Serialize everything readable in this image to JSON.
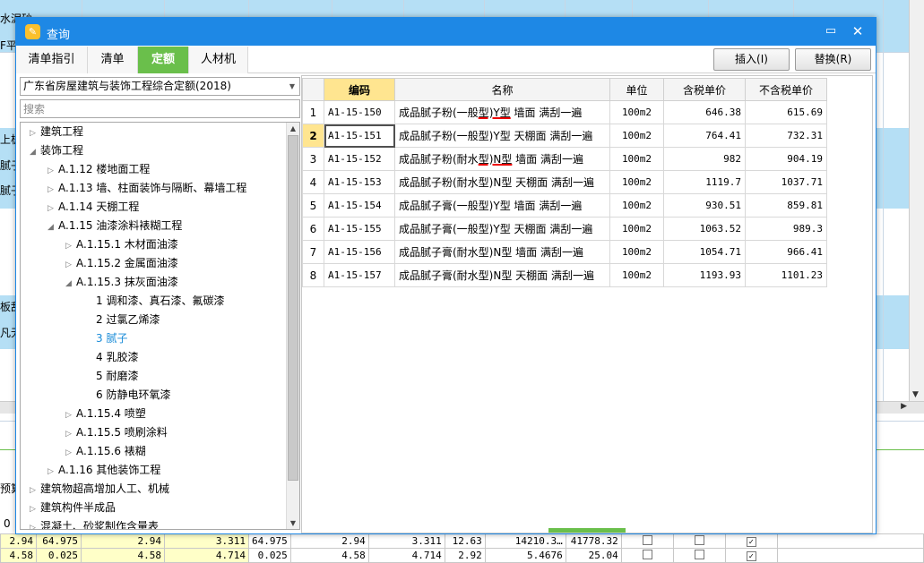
{
  "background": {
    "left_fragments": [
      "水泥砂",
      "F平",
      "上板",
      "腻子",
      "腻子",
      "板刮",
      "凡无机",
      "预算",
      "0"
    ],
    "bottom_rows": [
      {
        "cells": [
          "2.94",
          "64.975",
          "2.94",
          "3.311",
          "64.975",
          "2.94",
          "3.311",
          "12.63",
          "14210.3…",
          "41778.32"
        ],
        "checks": [
          false,
          false,
          true
        ]
      },
      {
        "cells": [
          "4.58",
          "0.025",
          "4.58",
          "4.714",
          "0.025",
          "4.58",
          "4.714",
          "2.92",
          "5.4676",
          "25.04"
        ],
        "checks": [
          false,
          false,
          true
        ]
      }
    ]
  },
  "dialog": {
    "title": "查询",
    "icons": {
      "app": "app-logo-icon",
      "minimize": "minimize-icon",
      "close": "close-icon"
    },
    "tabs": [
      {
        "label": "清单指引",
        "active": false
      },
      {
        "label": "清单",
        "active": false
      },
      {
        "label": "定额",
        "active": true
      },
      {
        "label": "人材机",
        "active": false
      }
    ],
    "insert_label": "插入(I)",
    "replace_label": "替换(R)",
    "accent": "#1e88e5",
    "tab_active_color": "#6abf4b"
  },
  "left": {
    "dept_select": "广东省房屋建筑与装饰工程综合定额(2018)",
    "search_placeholder": "搜索",
    "tree": [
      {
        "label": "建筑工程",
        "level": 0,
        "toggle": "▷"
      },
      {
        "label": "装饰工程",
        "level": 0,
        "toggle": "◢"
      },
      {
        "label": "A.1.12 楼地面工程",
        "level": 1,
        "toggle": "▷"
      },
      {
        "label": "A.1.13 墙、柱面装饰与隔断、幕墙工程",
        "level": 1,
        "toggle": "▷"
      },
      {
        "label": "A.1.14 天棚工程",
        "level": 1,
        "toggle": "▷"
      },
      {
        "label": "A.1.15 油漆涂料裱糊工程",
        "level": 1,
        "toggle": "◢"
      },
      {
        "label": "A.1.15.1 木材面油漆",
        "level": 2,
        "toggle": "▷"
      },
      {
        "label": "A.1.15.2 金属面油漆",
        "level": 2,
        "toggle": "▷"
      },
      {
        "label": "A.1.15.3 抹灰面油漆",
        "level": 2,
        "toggle": "◢"
      },
      {
        "label": "1 调和漆、真石漆、氟碳漆",
        "level": 3,
        "toggle": ""
      },
      {
        "label": "2 过氯乙烯漆",
        "level": 3,
        "toggle": ""
      },
      {
        "label": "3 腻子",
        "level": 3,
        "toggle": "",
        "selected": true
      },
      {
        "label": "4 乳胶漆",
        "level": 3,
        "toggle": ""
      },
      {
        "label": "5 耐磨漆",
        "level": 3,
        "toggle": ""
      },
      {
        "label": "6 防静电环氧漆",
        "level": 3,
        "toggle": ""
      },
      {
        "label": "A.1.15.4 喷塑",
        "level": 2,
        "toggle": "▷"
      },
      {
        "label": "A.1.15.5 喷刷涂料",
        "level": 2,
        "toggle": "▷"
      },
      {
        "label": "A.1.15.6 裱糊",
        "level": 2,
        "toggle": "▷"
      },
      {
        "label": "A.1.16 其他装饰工程",
        "level": 1,
        "toggle": "▷"
      },
      {
        "label": "建筑物超高增加人工、机械",
        "level": 0,
        "toggle": "▷"
      },
      {
        "label": "建筑构件半成品",
        "level": 0,
        "toggle": "▷"
      },
      {
        "label": "混凝土、砂浆制作含量表",
        "level": 0,
        "toggle": "▷"
      }
    ]
  },
  "grid": {
    "headers": [
      "编码",
      "名称",
      "单位",
      "含税单价",
      "不含税单价"
    ],
    "current_row": 2,
    "rows": [
      {
        "idx": "1",
        "code": "A1-15-150",
        "name_pre": "成品腻子粉(一般",
        "name_ul": "型)Y型",
        "name_post": " 墙面 满刮一遍",
        "unit": "100m2",
        "tax": "646.38",
        "notax": "615.69"
      },
      {
        "idx": "2",
        "code": "A1-15-151",
        "name_pre": "成品腻子粉(一般型)Y型 天棚面 满刮一遍",
        "name_ul": "",
        "name_post": "",
        "unit": "100m2",
        "tax": "764.41",
        "notax": "732.31"
      },
      {
        "idx": "3",
        "code": "A1-15-152",
        "name_pre": "成品腻子粉(耐水",
        "name_ul": "型)N型",
        "name_post": " 墙面 满刮一遍",
        "unit": "100m2",
        "tax": "982",
        "notax": "904.19"
      },
      {
        "idx": "4",
        "code": "A1-15-153",
        "name_pre": "成品腻子粉(耐水型)N型 天棚面 满刮一遍",
        "name_ul": "",
        "name_post": "",
        "unit": "100m2",
        "tax": "1119.7",
        "notax": "1037.71"
      },
      {
        "idx": "5",
        "code": "A1-15-154",
        "name_pre": "成品腻子膏(一般型)Y型 墙面 满刮一遍",
        "name_ul": "",
        "name_post": "",
        "unit": "100m2",
        "tax": "930.51",
        "notax": "859.81"
      },
      {
        "idx": "6",
        "code": "A1-15-155",
        "name_pre": "成品腻子膏(一般型)Y型 天棚面 满刮一遍",
        "name_ul": "",
        "name_post": "",
        "unit": "100m2",
        "tax": "1063.52",
        "notax": "989.3"
      },
      {
        "idx": "7",
        "code": "A1-15-156",
        "name_pre": "成品腻子膏(耐水型)N型 墙面 满刮一遍",
        "name_ul": "",
        "name_post": "",
        "unit": "100m2",
        "tax": "1054.71",
        "notax": "966.41"
      },
      {
        "idx": "8",
        "code": "A1-15-157",
        "name_pre": "成品腻子膏(耐水型)N型 天棚面 满刮一遍",
        "name_ul": "",
        "name_post": "",
        "unit": "100m2",
        "tax": "1193.93",
        "notax": "1101.23"
      }
    ]
  }
}
